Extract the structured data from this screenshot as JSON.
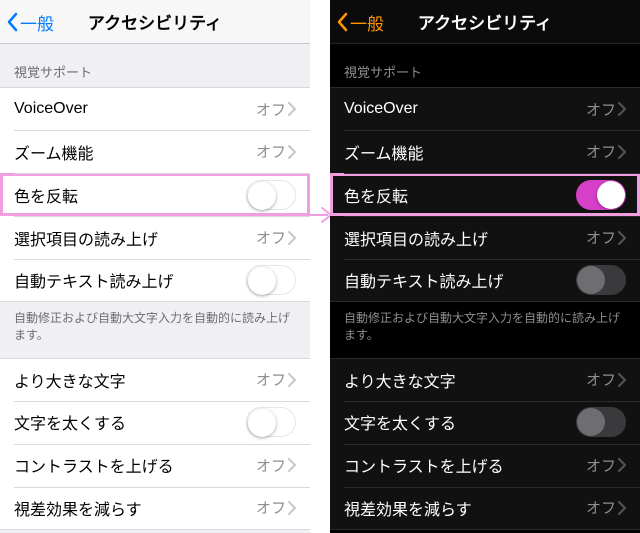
{
  "nav": {
    "back": "一般",
    "title": "アクセシビリティ"
  },
  "section1Header": "視覚サポート",
  "rows": {
    "voiceover": {
      "label": "VoiceOver",
      "value": "オフ"
    },
    "zoom": {
      "label": "ズーム機能",
      "value": "オフ"
    },
    "invert": {
      "label": "色を反転"
    },
    "speakSel": {
      "label": "選択項目の読み上げ",
      "value": "オフ"
    },
    "speakAuto": {
      "label": "自動テキスト読み上げ"
    },
    "largerType": {
      "label": "より大きな文字",
      "value": "オフ"
    },
    "boldText": {
      "label": "文字を太くする"
    },
    "contrast": {
      "label": "コントラストを上げる",
      "value": "オフ"
    },
    "reduceMotion": {
      "label": "視差効果を減らす",
      "value": "オフ"
    }
  },
  "footer1": "自動修正および自動大文字入力を自動的に読み上げます。"
}
